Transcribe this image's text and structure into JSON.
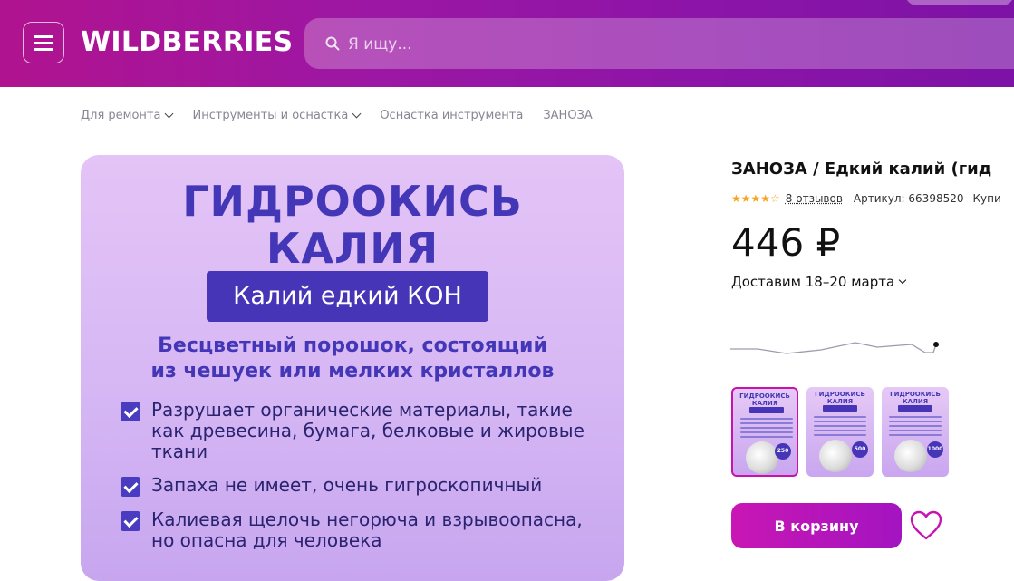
{
  "header": {
    "logo": "WILDBERRIES",
    "search_placeholder": "Я ищу..."
  },
  "breadcrumbs": [
    {
      "label": "Для ремонта",
      "has_dropdown": true
    },
    {
      "label": "Инструменты и оснастка",
      "has_dropdown": true
    },
    {
      "label": "Оснастка инструмента",
      "has_dropdown": false
    },
    {
      "label": "ЗАНОЗА",
      "has_dropdown": false
    }
  ],
  "image": {
    "title_line1": "ГИДРООКИСЬ",
    "title_line2": "КАЛИЯ",
    "badge": "Калий едкий КОН",
    "subtitle_line1": "Бесцветный порошок, состоящий",
    "subtitle_line2": "из чешуек или мелких кристаллов",
    "items": [
      "Разрушает органические материалы, такие как древесина, бумага, белковые и жировые ткани",
      "Запаха не имеет, очень гигроскопичный",
      "Калиевая щелочь негорюча и взрывоопасна, но опасна для человека"
    ]
  },
  "product": {
    "title": "ЗАНОЗА / Едкий калий (гид",
    "rating_stars": "★★★★☆",
    "rating": 4,
    "reviews": "8 отзывов",
    "article": "Артикул: 66398520",
    "buy_label": "Купи",
    "price": "446 ₽",
    "delivery": "Доставим 18–20 марта"
  },
  "thumbnails": [
    {
      "title": "ГИДРООКИСЬ КАЛИЯ",
      "tag": "250",
      "active": true
    },
    {
      "title": "ГИДРООКИСЬ КАЛИЯ",
      "tag": "500",
      "active": false
    },
    {
      "title": "ГИДРООКИСЬ КАЛИЯ",
      "tag": "1000",
      "active": false
    }
  ],
  "actions": {
    "cart_label": "В корзину"
  },
  "colors": {
    "brand_gradient_start": "#b0138f",
    "brand_gradient_end": "#7d12a6",
    "accent": "#cb11ab",
    "image_text": "#4337b8"
  }
}
